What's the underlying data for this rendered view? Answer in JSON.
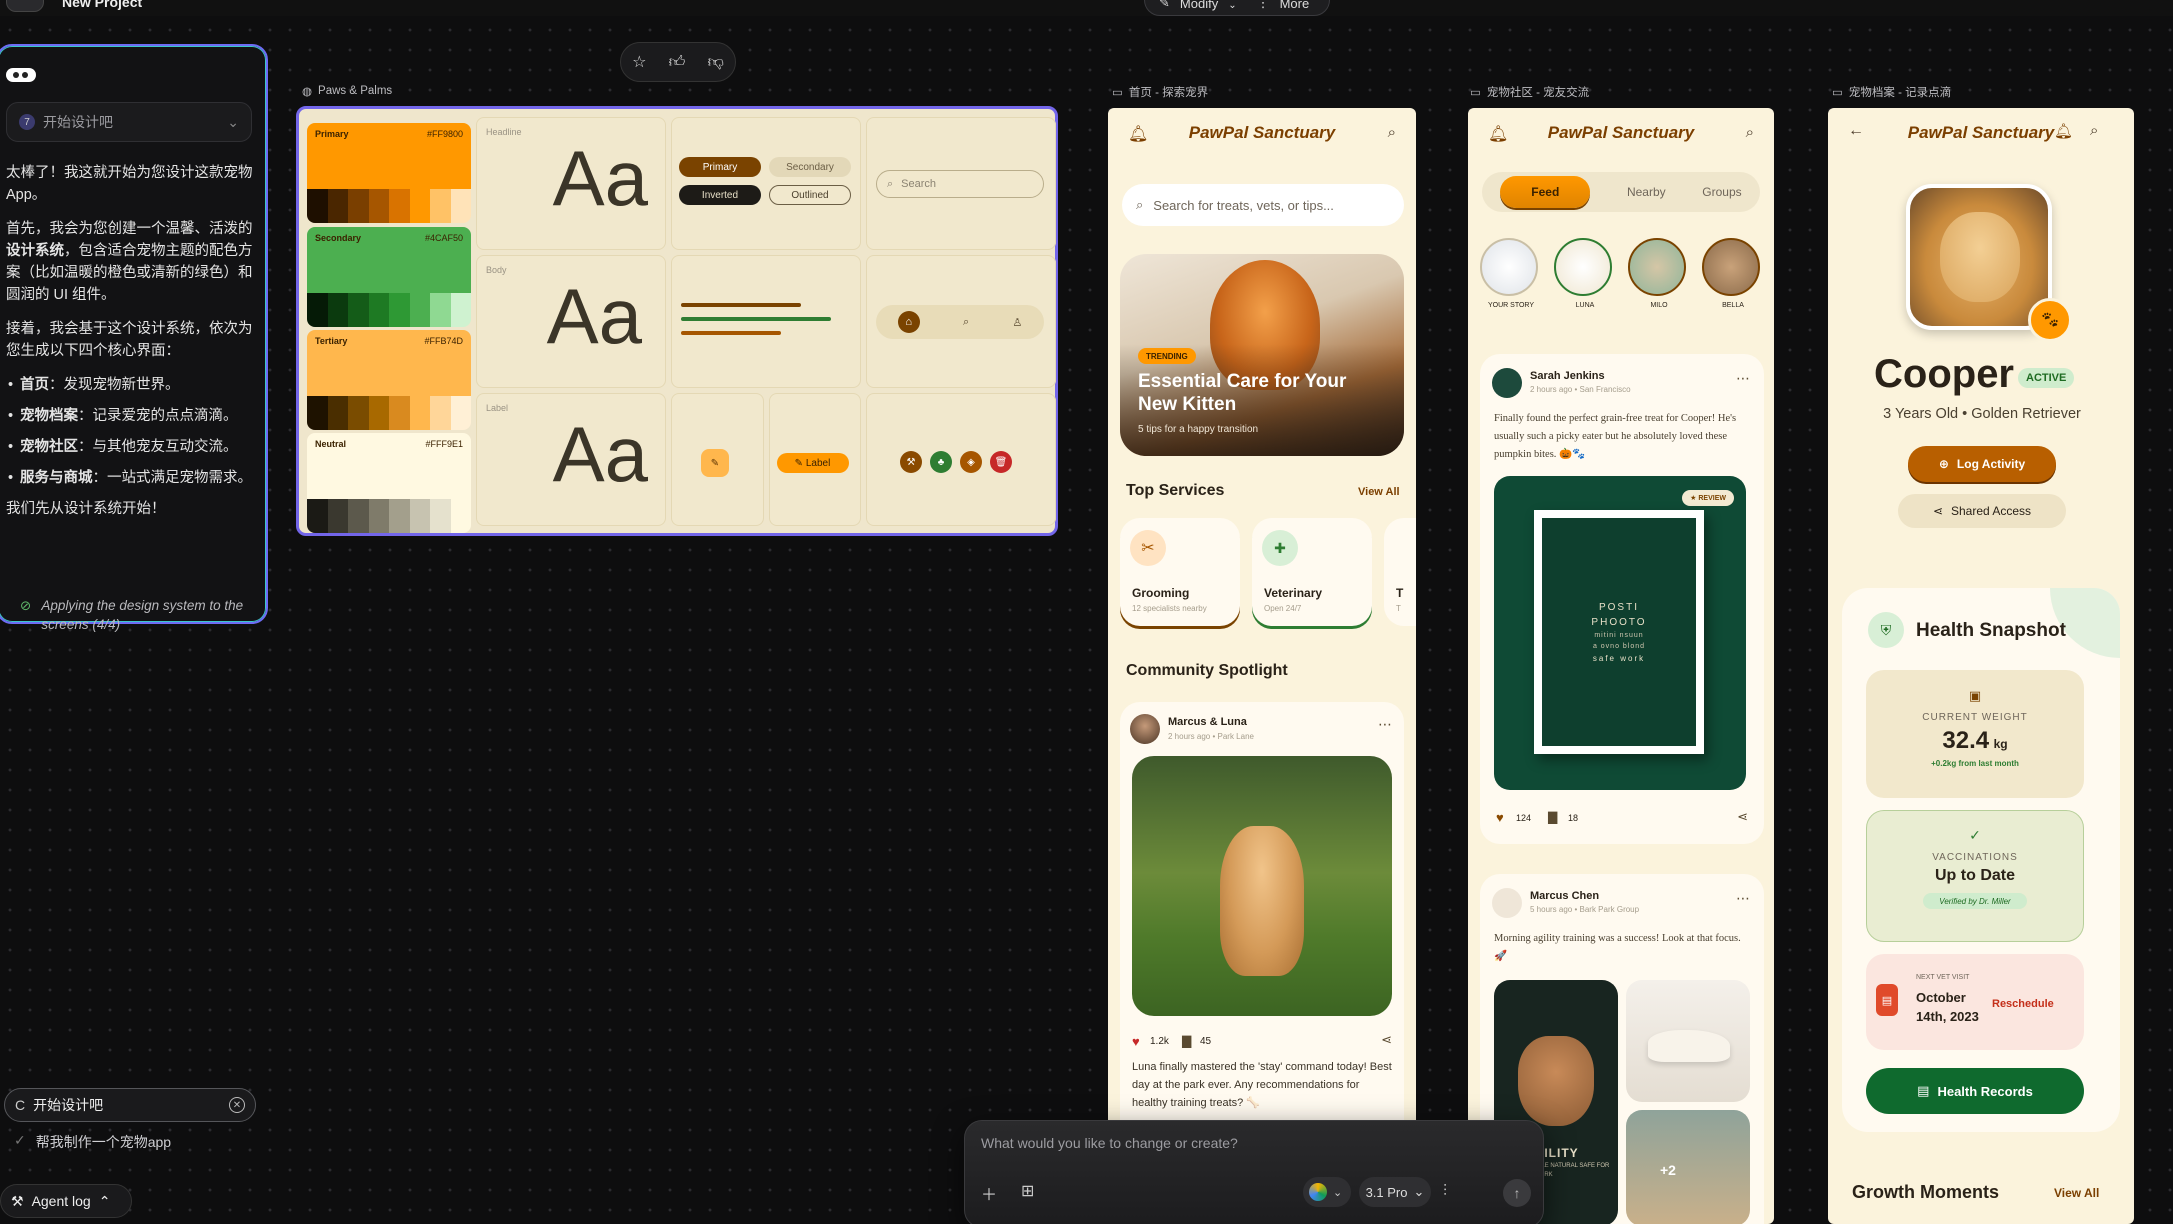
{
  "app": {
    "project_title": "New Project",
    "menu_icon": "hamburger-icon"
  },
  "toolbar": {
    "modify_label": "Modify",
    "more_label": "More"
  },
  "chat": {
    "selector_num": "7",
    "selector_label": "开始设计吧",
    "intro": "太棒了！我这就开始为您设计这款宠物App。",
    "para1_pre": "首先，我会为您创建一个温馨、活泼的",
    "para1_bold": "设计系统",
    "para1_post": "，包含适合宠物主题的配色方案（比如温暖的橙色或清新的绿色）和圆润的 UI 组件。",
    "para2": "接着，我会基于这个设计系统，依次为您生成以下四个核心界面：",
    "items": [
      {
        "bold": "首页",
        "text": "：发现宠物新世界。"
      },
      {
        "bold": "宠物档案",
        "text": "：记录爱宠的点点滴滴。"
      },
      {
        "bold": "宠物社区",
        "text": "：与其他宠友互动交流。"
      },
      {
        "bold": "服务与商城",
        "text": "：一站式满足宠物需求。"
      }
    ],
    "closing": "我们先从设计系统开始！",
    "status": "Applying the design system to the screens (4/4)",
    "input_value": "开始设计吧",
    "suggestion": "帮我制作一个宠物app",
    "agent_log": "Agent log"
  },
  "frames": {
    "design_system": "Paws & Palms",
    "home": "首页 - 探索宠界",
    "community": "宠物社区 - 宠友交流",
    "profile": "宠物档案 - 记录点滴"
  },
  "design_system": {
    "swatches": [
      {
        "name": "Primary",
        "hex": "#FF9800",
        "color": "#ff9800",
        "shades": [
          "#1e0f00",
          "#4a2600",
          "#7a3f00",
          "#a65600",
          "#d97300",
          "#ff9800",
          "#ffc266",
          "#ffe3b8"
        ]
      },
      {
        "name": "Secondary",
        "hex": "#4CAF50",
        "color": "#4caf50",
        "shades": [
          "#051a06",
          "#0b3a0e",
          "#145c18",
          "#1e7a23",
          "#2e9934",
          "#4caf50",
          "#8fd992",
          "#cff2d0"
        ]
      },
      {
        "name": "Tertiary",
        "hex": "#FFB74D",
        "color": "#ffb74d",
        "shades": [
          "#1e1200",
          "#4a2e00",
          "#7a4c00",
          "#a86900",
          "#d98a1f",
          "#ffb74d",
          "#ffd699",
          "#fff0d6"
        ]
      },
      {
        "name": "Neutral",
        "hex": "#FFF9E1",
        "color": "#fff9e1",
        "shades": [
          "#1b1a15",
          "#3a382f",
          "#5c594c",
          "#7f7b6a",
          "#a39f8c",
          "#c7c3b0",
          "#e5e1cd",
          "#fff9e1"
        ]
      }
    ],
    "type_labels": {
      "headline": "Headline",
      "body": "Body",
      "label": "Label"
    },
    "type_sample": "Aa",
    "buttons": {
      "primary": "Primary",
      "secondary": "Secondary",
      "inverted": "Inverted",
      "outlined": "Outlined"
    },
    "search_placeholder": "Search",
    "label_button": "Label"
  },
  "home": {
    "title": "PawPal Sanctuary",
    "search_placeholder": "Search for treats, vets, or tips...",
    "hero_badge": "TRENDING",
    "hero_title": "Essential Care for Your New Kitten",
    "hero_sub": "5 tips for a happy transition",
    "services_title": "Top Services",
    "services_link": "View All",
    "services": [
      {
        "name": "Grooming",
        "sub": "12 specialists nearby",
        "icon": "scissors-icon"
      },
      {
        "name": "Veterinary",
        "sub": "Open 24/7",
        "icon": "medical-kit-icon"
      },
      {
        "name": "T",
        "sub": "T",
        "icon": "partial-icon"
      }
    ],
    "spotlight_title": "Community Spotlight",
    "post_author": "Marcus & Luna",
    "post_meta": "2 hours ago • Park Lane",
    "likes": "1.2k",
    "comments": "45",
    "post_text": "Luna finally mastered the 'stay' command today! Best day at the park ever. Any recommendations for healthy training treats? 🦴"
  },
  "community": {
    "title": "PawPal Sanctuary",
    "tabs": [
      "Feed",
      "Nearby",
      "Groups"
    ],
    "stories": [
      "YOUR STORY",
      "LUNA",
      "MILO",
      "BELLA"
    ],
    "post1_author": "Sarah Jenkins",
    "post1_meta": "2 hours ago • San Francisco",
    "post1_text": "Finally found the perfect grain-free treat for Cooper! He's usually such a picky eater but he absolutely loved these pumpkin bites. 🎃🐾",
    "post1_badge": "★ REVIEW",
    "poster_lines": [
      "POSTI",
      "PHOOTO",
      "mitini nsuun",
      "a ovno blond",
      "safe work"
    ],
    "post1_likes": "124",
    "post1_comments": "18",
    "post2_author": "Marcus Chen",
    "post2_meta": "5 hours ago • Bark Park Group",
    "post2_text": "Morning agility training was a success! Look at that focus. 🚀",
    "agility_text": "GILITY",
    "agility_sub": "ALLE NATURAL SAFE FOR WORK",
    "more_count": "+2"
  },
  "profile": {
    "title": "PawPal Sanctuary",
    "pet_name": "Cooper",
    "status": "ACTIVE",
    "pet_desc": "3 Years Old • Golden Retriever",
    "log_btn": "Log Activity",
    "share_btn": "Shared Access",
    "health_title": "Health Snapshot",
    "weight_label": "CURRENT WEIGHT",
    "weight_value": "32.4",
    "weight_unit": "kg",
    "weight_delta": "+0.2kg from last month",
    "vacc_label": "VACCINATIONS",
    "vacc_value": "Up to Date",
    "vacc_note": "Verified by Dr. Miller",
    "visit_label": "NEXT VET VISIT",
    "visit_date": "October 14th, 2023",
    "reschedule": "Reschedule",
    "records_btn": "Health Records",
    "growth_title": "Growth Moments",
    "growth_link": "View All"
  },
  "composer": {
    "placeholder": "What would you like to change or create?",
    "model_version": "3.1 Pro"
  }
}
